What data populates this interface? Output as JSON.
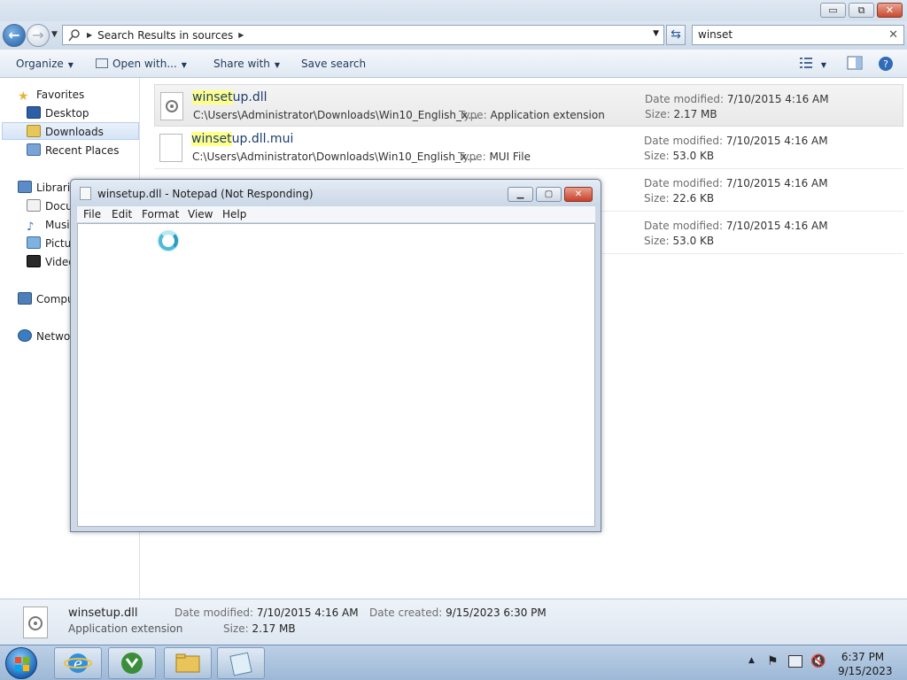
{
  "explorer": {
    "window_buttons": {
      "minimize": "▭",
      "maximize": "⧉",
      "close": "✕"
    },
    "address": {
      "breadcrumb": "Search Results in sources"
    },
    "search": {
      "value": "winset"
    },
    "toolbar": {
      "organize": "Organize",
      "open_with": "Open with...",
      "share_with": "Share with",
      "save_search": "Save search"
    },
    "nav": {
      "favorites": "Favorites",
      "desktop": "Desktop",
      "downloads": "Downloads",
      "recent_places": "Recent Places",
      "libraries": "Librarie",
      "documents": "Docu",
      "music": "Music",
      "pictures": "Pictu",
      "videos": "Video",
      "computer": "Compu",
      "network": "Netwo"
    },
    "results": [
      {
        "name_hl": "winset",
        "name_rest": "up.dll",
        "path": "C:\\Users\\Administrator\\Downloads\\Win10_English_x...",
        "type_label": "Type:",
        "type": "Application extension",
        "date_label": "Date modified:",
        "date": "7/10/2015 4:16 AM",
        "size_label": "Size:",
        "size": "2.17 MB"
      },
      {
        "name_hl": "winset",
        "name_rest": "up.dll.mui",
        "path": "C:\\Users\\Administrator\\Downloads\\Win10_English_x...",
        "type_label": "Type:",
        "type": "MUI File",
        "date_label": "Date modified:",
        "date": "7/10/2015 4:16 AM",
        "size_label": "Size:",
        "size": "53.0 KB"
      },
      {
        "date_label": "Date modified:",
        "date": "7/10/2015 4:16 AM",
        "size_label": "Size:",
        "size": "22.6 KB"
      },
      {
        "date_label": "Date modified:",
        "date": "7/10/2015 4:16 AM",
        "size_label": "Size:",
        "size": "53.0 KB"
      }
    ],
    "details": {
      "name": "winsetup.dll",
      "type": "Application extension",
      "date_modified_label": "Date modified:",
      "date_modified": "7/10/2015 4:16 AM",
      "size_label": "Size:",
      "size": "2.17 MB",
      "date_created_label": "Date created:",
      "date_created": "9/15/2023 6:30 PM"
    }
  },
  "notepad": {
    "title": "winsetup.dll - Notepad (Not Responding)",
    "menu": [
      "File",
      "Edit",
      "Format",
      "View",
      "Help"
    ],
    "buttons": {
      "minimize": "▁",
      "maximize": "▢",
      "close": "✕"
    }
  },
  "taskbar": {
    "clock_time": "6:37 PM",
    "clock_date": "9/15/2023"
  }
}
